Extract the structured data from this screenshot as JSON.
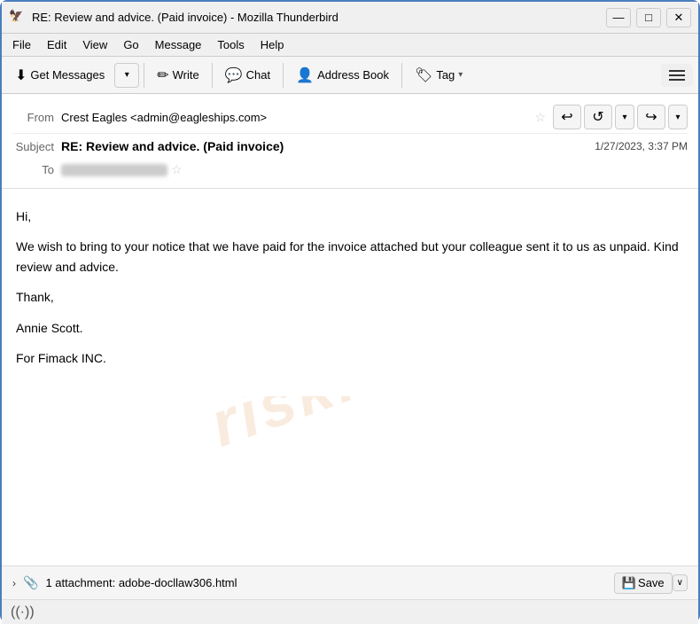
{
  "titlebar": {
    "title": "RE: Review and advice. (Paid invoice) - Mozilla Thunderbird",
    "icon": "🦅",
    "minimize": "—",
    "maximize": "□",
    "close": "✕"
  },
  "menubar": {
    "items": [
      "File",
      "Edit",
      "View",
      "Go",
      "Message",
      "Tools",
      "Help"
    ]
  },
  "toolbar": {
    "get_messages": "Get Messages",
    "write": "Write",
    "chat": "Chat",
    "address_book": "Address Book",
    "tag": "Tag",
    "hamburger": ""
  },
  "email": {
    "from_label": "From",
    "from_value": "Crest Eagles <admin@eagleships.com>",
    "subject_label": "Subject",
    "subject_value": "RE: Review and advice. (Paid invoice)",
    "date": "1/27/2023, 3:37 PM",
    "to_label": "To",
    "body_greeting": "Hi,",
    "body_paragraph": "We wish to bring to your notice that we have paid for the invoice attached but your colleague sent it to us as unpaid. Kind review and advice.",
    "body_thanks": "Thank,",
    "body_signature_line1": "Annie Scott.",
    "body_signature_line2": "For Fimack INC."
  },
  "attachment": {
    "expand_icon": "›",
    "clip_icon": "📎",
    "text": "1 attachment: adobe-docllaw306.html",
    "save_label": "Save",
    "dropdown_arrow": "∨"
  },
  "statusbar": {
    "icon": "((·))"
  },
  "watermark": "risk.com"
}
